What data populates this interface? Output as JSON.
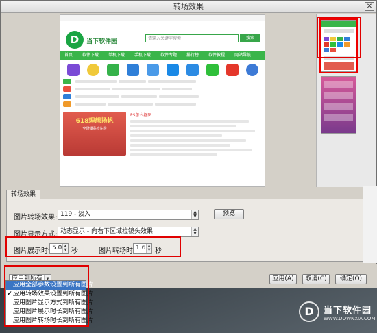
{
  "window": {
    "title": "转场效果"
  },
  "preview": {
    "site_name": "当下软件园",
    "search_placeholder": "请输入关键字搜索",
    "search_button": "搜索",
    "nav": [
      "首页",
      "软件下载",
      "单机下载",
      "手机下载",
      "软件专题",
      "排行榜",
      "软件教程",
      "网站导航"
    ],
    "banner_title": "618理想扬帆",
    "banner_sub": "全场爆品抢先购",
    "section_title": "PS怎么抠图"
  },
  "tabs": {
    "effect_tab": "转场效果"
  },
  "settings": {
    "transition_label": "图片转场效果:",
    "transition_value": "119 - 淡入",
    "preview_button": "预览",
    "display_mode_label": "图片显示方式:",
    "display_mode_value": "动态显示 - 向右下区域拉镜头效果",
    "display_duration_label": "图片展示时长:",
    "display_duration_value": "5.0",
    "display_duration_unit": "秒",
    "transition_duration_label": "图片转场时长:",
    "transition_duration_value": "1.6",
    "transition_duration_unit": "秒"
  },
  "bottom": {
    "apply_all_select": "应用到所有",
    "apply_button": "应用(A)",
    "cancel_button": "取消(C)",
    "ok_button": "确定(O)"
  },
  "dropdown": {
    "items": [
      "应用全部参数设置到所有图片",
      "应用转场效果设置到所有图片",
      "应用图片显示方式到所有图片",
      "应用图片展示时长到所有图片",
      "应用图片转场时长到所有图片"
    ],
    "highlighted_index": 0,
    "checked_index": 1
  },
  "watermark": {
    "name": "当下软件园",
    "url": "WWW.DOWNXIA.COM"
  },
  "colors": {
    "highlight_red": "#e00000",
    "selection_blue": "#3a75c4",
    "brand_green": "#3ab54a"
  }
}
